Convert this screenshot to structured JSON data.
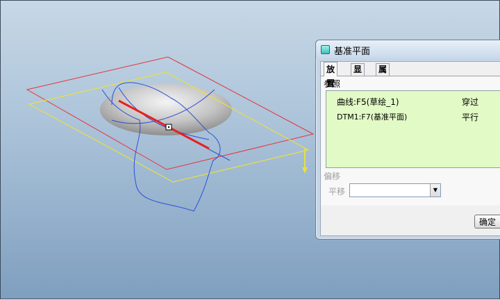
{
  "dialog": {
    "title": "基准平面",
    "tabs": [
      "放置",
      "显示",
      "属性"
    ],
    "reference_label": "参照",
    "references": [
      {
        "name": "曲线:F5(草绘_1)",
        "type": "穿过"
      },
      {
        "name": "DTM1:F7(基准平面)",
        "type": "平行"
      }
    ],
    "offset_label": "偏移",
    "translation_label": "平移",
    "translation_value": "",
    "ok_label": "确定"
  },
  "colors": {
    "datum_plane_red": "#e8303a",
    "datum_plane_yellow": "#e8e040",
    "curve_blue": "#2a4fd8",
    "axis_red": "#e82020",
    "reference_list_bg": "#e2fac6"
  },
  "icons": [
    "datum-plane-icon",
    "dropdown-arrow-icon",
    "direction-arrow-icon"
  ]
}
